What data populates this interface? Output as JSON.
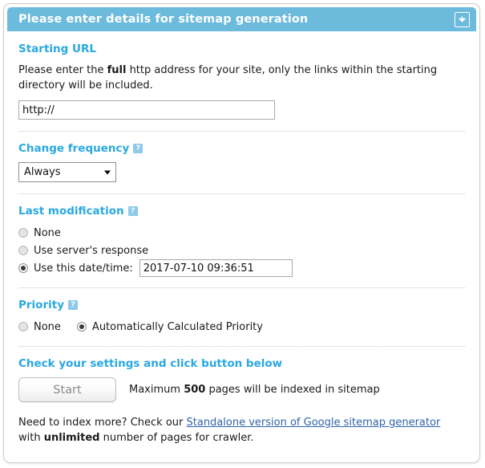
{
  "panel": {
    "header": {
      "title": "Please enter details for sitemap generation",
      "collapse_icon": "collapse-down-icon"
    },
    "accent_color": "#6cbadc",
    "heading_color": "#29a8e0",
    "link_color": "#2e64a8"
  },
  "starting_url": {
    "heading": "Starting URL",
    "desc_part1": "Please enter the ",
    "desc_bold": "full",
    "desc_part2": " http address for your site, only the links within the starting directory will be included.",
    "input_value": "http://",
    "input_placeholder": "http://"
  },
  "change_frequency": {
    "heading": "Change frequency",
    "help_badge": "?",
    "selected": "Always",
    "options": [
      "Always"
    ]
  },
  "last_modification": {
    "heading": "Last modification",
    "help_badge": "?",
    "options": [
      {
        "label": "None",
        "checked": false
      },
      {
        "label": "Use server's response",
        "checked": false
      },
      {
        "label": "Use this date/time:",
        "checked": true
      }
    ],
    "date_value": "2017-07-10 09:36:51"
  },
  "priority": {
    "heading": "Priority",
    "help_badge": "?",
    "options": [
      {
        "label": "None",
        "checked": false
      },
      {
        "label": "Automatically Calculated Priority",
        "checked": true
      }
    ]
  },
  "check_settings": {
    "heading": "Check your settings and click button below",
    "start_label": "Start",
    "note_part1": "Maximum ",
    "note_bold": "500",
    "note_part2": " pages will be indexed in sitemap"
  },
  "footer": {
    "part1": "Need to index more? Check our ",
    "link": "Standalone version of Google sitemap generator",
    "part2": " with ",
    "bold": "unlimited",
    "part3": " number of pages for crawler."
  }
}
